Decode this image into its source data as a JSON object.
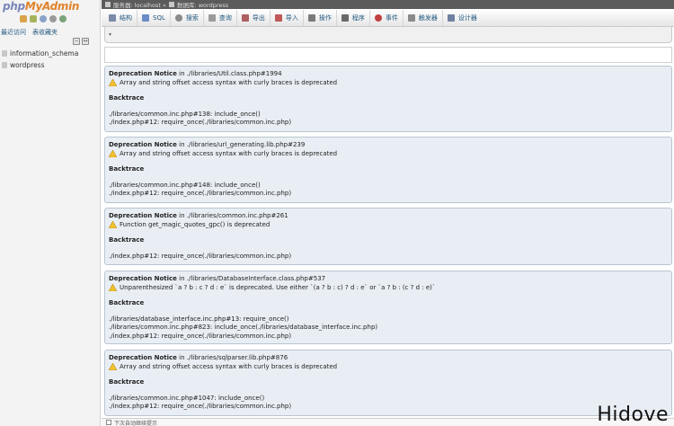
{
  "logo": {
    "php": "php",
    "my": "My",
    "admin": "Admin"
  },
  "nav": {
    "tabs": [
      "最近访问",
      "表收藏夹"
    ]
  },
  "databases": [
    {
      "name": "information_schema"
    },
    {
      "name": "wordpress"
    }
  ],
  "breadcrumb": {
    "server": "服务器: localhost »",
    "db": "数据库: wordpress"
  },
  "menu": [
    {
      "label": "结构",
      "icon": "structure-icon",
      "color": "#7a8aa8"
    },
    {
      "label": "SQL",
      "icon": "sql-icon",
      "color": "#6b8cc8"
    },
    {
      "label": "搜索",
      "icon": "search-icon",
      "color": "#8a8a8a"
    },
    {
      "label": "查询",
      "icon": "query-icon",
      "color": "#9a9a9a"
    },
    {
      "label": "导出",
      "icon": "export-icon",
      "color": "#b06060"
    },
    {
      "label": "导入",
      "icon": "import-icon",
      "color": "#c05858"
    },
    {
      "label": "操作",
      "icon": "wrench-icon",
      "color": "#7a7a7a"
    },
    {
      "label": "程序",
      "icon": "routines-icon",
      "color": "#6a6a6a"
    },
    {
      "label": "事件",
      "icon": "clock-icon",
      "color": "#c04040"
    },
    {
      "label": "触发器",
      "icon": "triggers-icon",
      "color": "#8a8a8a"
    },
    {
      "label": "设计器",
      "icon": "designer-icon",
      "color": "#7080a0"
    }
  ],
  "notices": [
    {
      "label": "Deprecation Notice",
      "location": " in ./libraries/Util.class.php#1994",
      "message": "Array and string offset access syntax with curly braces is deprecated",
      "backtrace_label": "Backtrace",
      "trace": [
        "./libraries/common.inc.php#138: include_once()",
        "./index.php#12: require_once(./libraries/common.inc.php)"
      ]
    },
    {
      "label": "Deprecation Notice",
      "location": " in ./libraries/url_generating.lib.php#239",
      "message": "Array and string offset access syntax with curly braces is deprecated",
      "backtrace_label": "Backtrace",
      "trace": [
        "./libraries/common.inc.php#148: include_once()",
        "./index.php#12: require_once(./libraries/common.inc.php)"
      ]
    },
    {
      "label": "Deprecation Notice",
      "location": " in ./libraries/common.inc.php#261",
      "message": "Function get_magic_quotes_gpc() is deprecated",
      "backtrace_label": "Backtrace",
      "trace": [
        "./index.php#12: require_once(./libraries/common.inc.php)"
      ]
    },
    {
      "label": "Deprecation Notice",
      "location": " in ./libraries/DatabaseInterface.class.php#537",
      "message": "Unparenthesized `a ? b : c ? d : e` is deprecated. Use either `(a ? b : c) ? d : e` or `a ? b : (c ? d : e)`",
      "backtrace_label": "Backtrace",
      "trace": [
        "./libraries/database_interface.inc.php#13: require_once()",
        "./libraries/common.inc.php#823: include_once(./libraries/database_interface.inc.php)",
        "./index.php#12: require_once(./libraries/common.inc.php)"
      ]
    },
    {
      "label": "Deprecation Notice",
      "location": " in ./libraries/sqlparser.lib.php#876",
      "message": "Array and string offset access syntax with curly braces is deprecated",
      "backtrace_label": "Backtrace",
      "trace": [
        "./libraries/common.inc.php#1047: include_once()",
        "./index.php#12: require_once(./libraries/common.inc.php)"
      ]
    }
  ],
  "bottom": {
    "label": "下次自动继续提示"
  },
  "watermark": "Hidove"
}
